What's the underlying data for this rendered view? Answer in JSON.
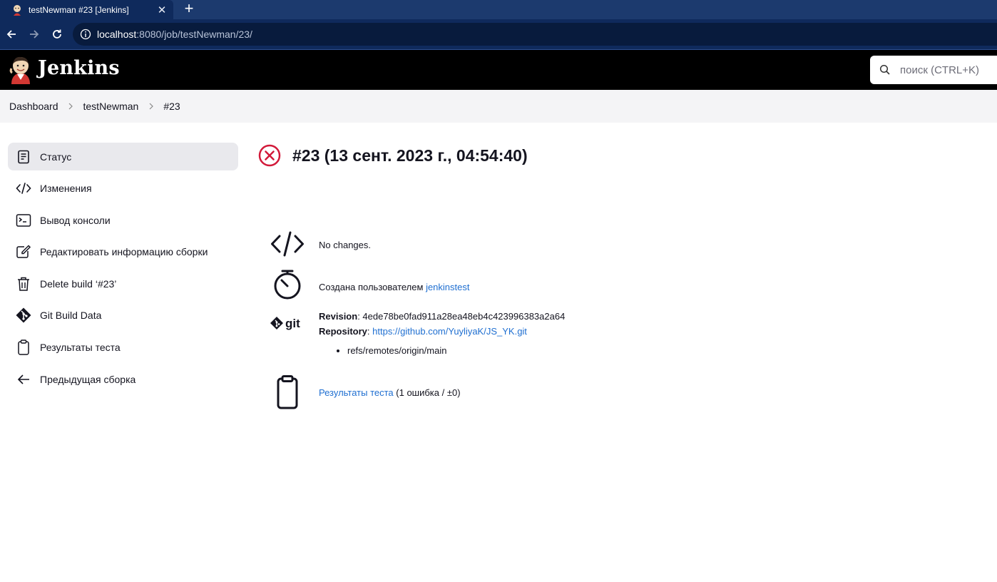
{
  "browser": {
    "tab_title": "testNewman #23 [Jenkins]",
    "tab_close": "✕",
    "new_tab": "+",
    "url_host": "localhost",
    "url_path": ":8080/job/testNewman/23/"
  },
  "header": {
    "title": "Jenkins",
    "search_placeholder": "поиск (CTRL+K)"
  },
  "breadcrumb": [
    "Dashboard",
    "testNewman",
    "#23"
  ],
  "sidebar": {
    "items": [
      {
        "label": "Статус",
        "icon": "status-icon"
      },
      {
        "label": "Изменения",
        "icon": "code-icon"
      },
      {
        "label": "Вывод консоли",
        "icon": "terminal-icon"
      },
      {
        "label": "Редактировать информацию сборки",
        "icon": "edit-icon"
      },
      {
        "label": "Delete build ‘#23’",
        "icon": "trash-icon"
      },
      {
        "label": "Git Build Data",
        "icon": "git-icon"
      },
      {
        "label": "Результаты теста",
        "icon": "clipboard-icon"
      },
      {
        "label": "Предыдущая сборка",
        "icon": "arrow-left-icon"
      }
    ]
  },
  "main": {
    "title": "#23 (13 сент. 2023 г., 04:54:40)",
    "status_color": "#d21a3a",
    "changes_text": "No changes.",
    "started_by_prefix": "Создана пользователем",
    "started_by_user": "jenkinstest",
    "git_logo_text": "git",
    "revision_label": "Revision",
    "revision_value": ": 4ede78be0fad911a28ea48eb4c423996383a2a64",
    "repository_label": "Repository",
    "repository_sep": ": ",
    "repository_url": "https://github.com/YuyliyaK/JS_YK.git",
    "branches": [
      "refs/remotes/origin/main"
    ],
    "test_results_link": "Результаты теста",
    "test_results_summary": " (1 ошибка / ±0)"
  }
}
